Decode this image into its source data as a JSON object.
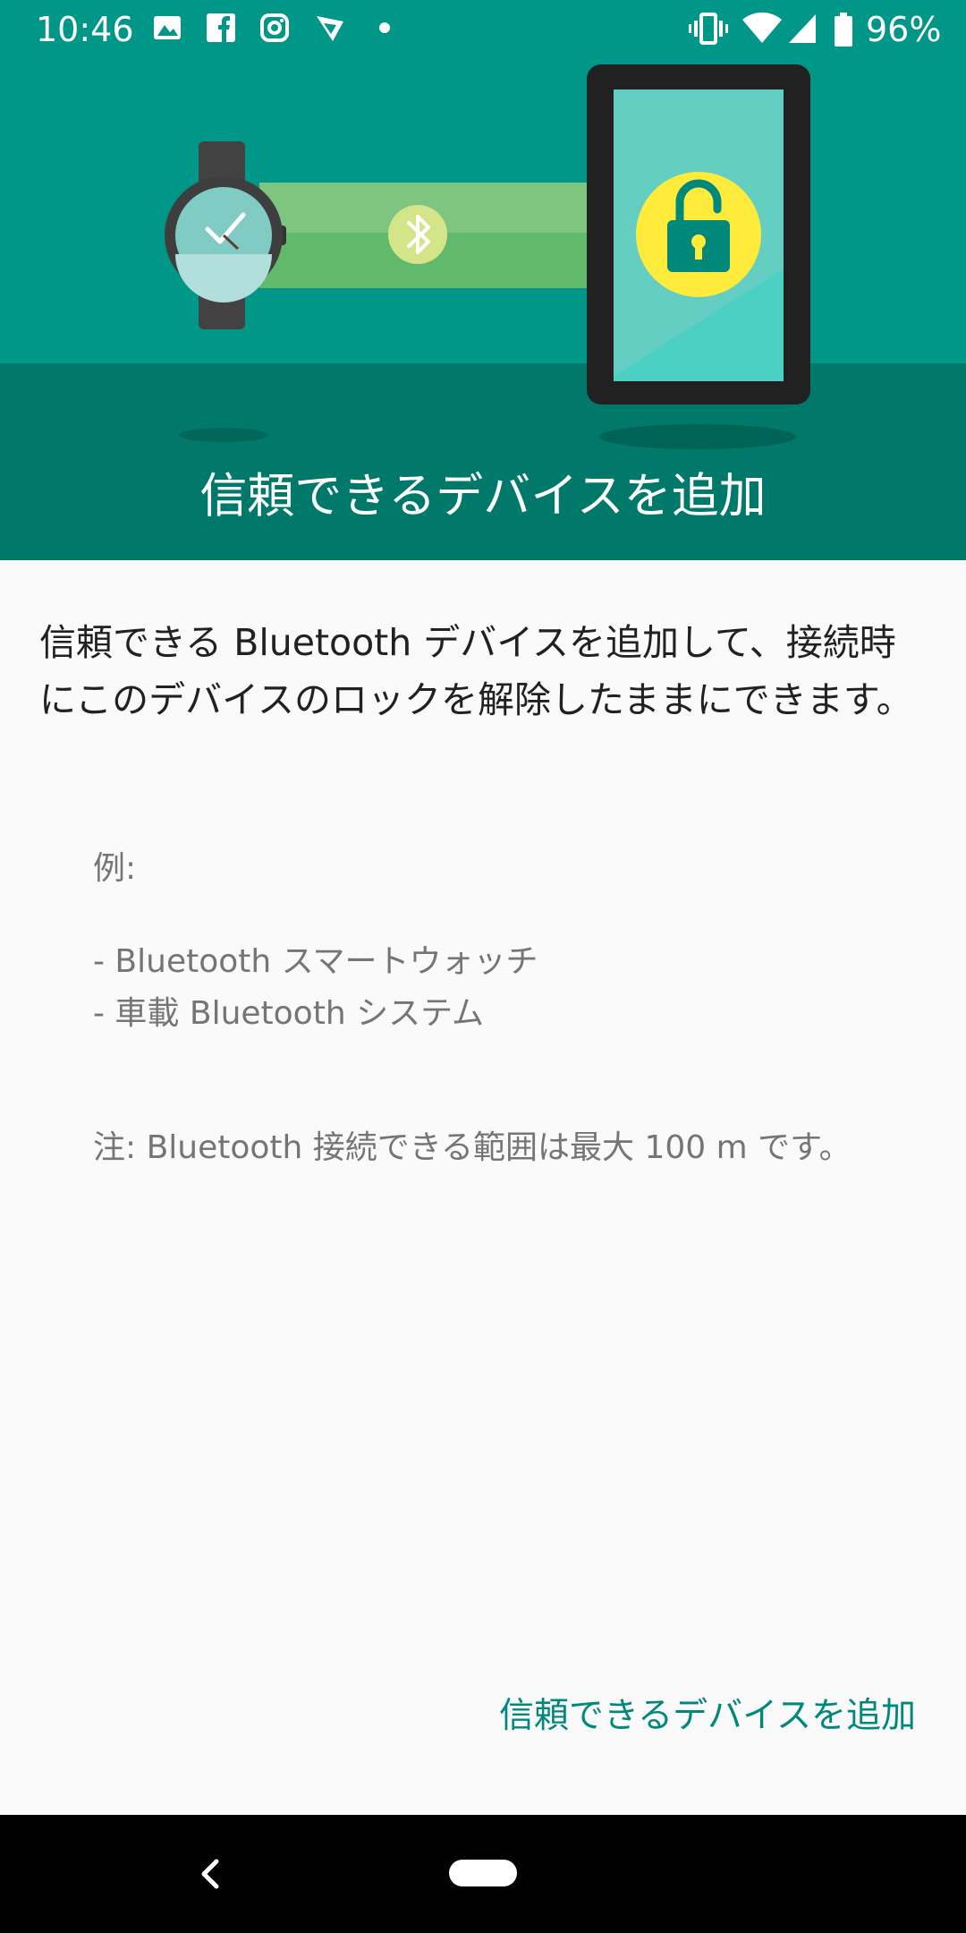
{
  "status_bar": {
    "time": "10:46",
    "battery_percent": "96%",
    "notification_icons": [
      "image-icon",
      "facebook-icon",
      "instagram-icon",
      "ghostery-icon",
      "dot-icon"
    ],
    "system_icons": [
      "vibrate-icon",
      "wifi-icon",
      "cellular-icon",
      "battery-icon"
    ]
  },
  "header": {
    "title": "信頼できるデバイスを追加",
    "illustration": {
      "icons": [
        "smartwatch-icon",
        "bluetooth-icon",
        "tablet-icon",
        "unlock-icon"
      ]
    }
  },
  "content": {
    "description": "信頼できる Bluetooth デバイスを追加して、接続時にこのデバイスのロックを解除したままにできます。",
    "examples_label": "例:",
    "examples": [
      "- Bluetooth スマートウォッチ",
      "- 車載 Bluetooth システム"
    ],
    "note": "注: Bluetooth 接続できる範囲は最大 100 m です。"
  },
  "actions": {
    "add_button_label": "信頼できるデバイスを追加"
  },
  "colors": {
    "primary": "#009688",
    "primary_dark": "#00796b",
    "accent_text": "#00897b",
    "lock_circle": "#ffeb3b"
  }
}
